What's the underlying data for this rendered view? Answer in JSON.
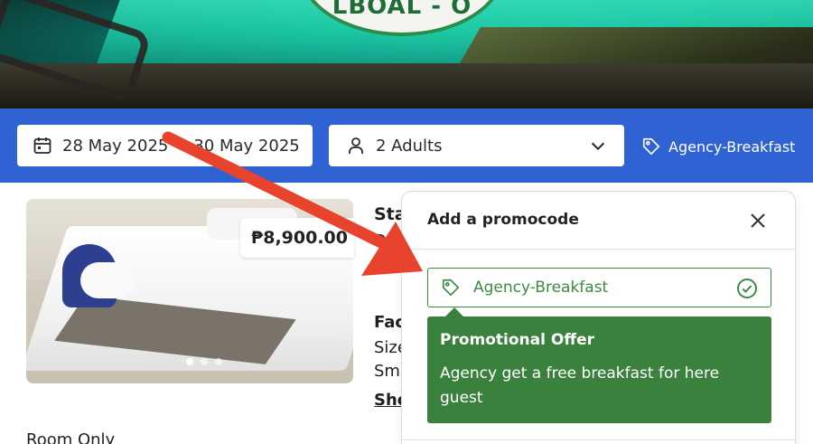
{
  "hero": {
    "logo_text": "LBOAL - O"
  },
  "booking_bar": {
    "dates_label": "28 May 2025",
    "dates_label_end": "30 May 2025",
    "guests_label": "2 Adults",
    "promo_applied": "Agency-Breakfast",
    "calendar_icon": "calendar-icon",
    "person_icon": "person-icon",
    "chevron_icon": "chevron-down-icon",
    "tag_icon": "tag-icon"
  },
  "room": {
    "price": "₱8,900.00",
    "title_partial": "Sta",
    "line_partial": "D",
    "facilities_partial": "Fac",
    "size_partial": "Size",
    "sm_partial": "Sm",
    "show_partial": "Sho",
    "rate_label": "Room Only"
  },
  "promo_panel": {
    "title": "Add a promocode",
    "input_value": "Agency-Breakfast",
    "offer_title": "Promotional Offer",
    "offer_body": "Agency get a free breakfast for here guest"
  },
  "colors": {
    "bar_blue": "#2f63d4",
    "success_green": "#3a813e",
    "annotation_red": "#e8442d"
  }
}
